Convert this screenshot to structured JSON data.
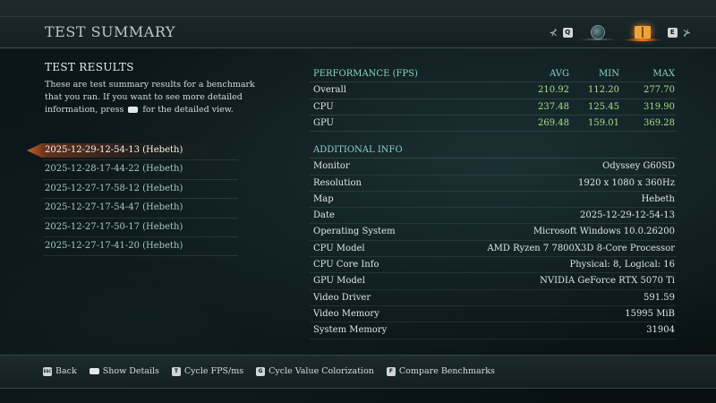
{
  "header": {
    "title": "TEST SUMMARY",
    "prev_key": "Q",
    "next_key": "E"
  },
  "results": {
    "heading": "TEST RESULTS",
    "desc_part1": "These are test summary results for a benchmark that you ran. If you want to see more detailed information, press",
    "desc_part2": "for the detailed view."
  },
  "runs": [
    "2025-12-29-12-54-13 (Hebeth)",
    "2025-12-28-17-44-22 (Hebeth)",
    "2025-12-27-17-58-12 (Hebeth)",
    "2025-12-27-17-54-47 (Hebeth)",
    "2025-12-27-17-50-17 (Hebeth)",
    "2025-12-27-17-41-20 (Hebeth)"
  ],
  "performance": {
    "header": {
      "label": "PERFORMANCE (FPS)",
      "avg": "AVG",
      "min": "MIN",
      "max": "MAX"
    },
    "rows": [
      {
        "label": "Overall",
        "avg": "210.92",
        "min": "112.20",
        "max": "277.70"
      },
      {
        "label": "CPU",
        "avg": "237.48",
        "min": "125.45",
        "max": "319.90"
      },
      {
        "label": "GPU",
        "avg": "269.48",
        "min": "159.01",
        "max": "369.28"
      }
    ]
  },
  "additional": {
    "heading": "ADDITIONAL INFO",
    "rows": [
      {
        "key": "Monitor",
        "value": "Odyssey G60SD"
      },
      {
        "key": "Resolution",
        "value": "1920 x 1080 x 360Hz"
      },
      {
        "key": "Map",
        "value": "Hebeth"
      },
      {
        "key": "Date",
        "value": "2025-12-29-12-54-13"
      },
      {
        "key": "Operating System",
        "value": "Microsoft Windows 10.0.26200"
      },
      {
        "key": "CPU Model",
        "value": "AMD Ryzen 7 7800X3D 8-Core Processor"
      },
      {
        "key": "CPU Core Info",
        "value": "Physical: 8, Logical: 16"
      },
      {
        "key": "GPU Model",
        "value": "NVIDIA GeForce RTX 5070 Ti"
      },
      {
        "key": "Video Driver",
        "value": "591.59"
      },
      {
        "key": "Video Memory",
        "value": "15995 MiB"
      },
      {
        "key": "System Memory",
        "value": "31904"
      }
    ]
  },
  "footer": {
    "back": {
      "key": "ESC",
      "label": "Back"
    },
    "show_details": {
      "label": "Show Details"
    },
    "cycle_fps": {
      "key": "T",
      "label": "Cycle FPS/ms"
    },
    "cycle_color": {
      "key": "G",
      "label": "Cycle Value Colorization"
    },
    "compare": {
      "key": "F",
      "label": "Compare Benchmarks"
    }
  },
  "colors": {
    "accent_orange": "#f0a23a",
    "value_green": "#a6de8a",
    "header_teal": "#8ed0c6"
  }
}
